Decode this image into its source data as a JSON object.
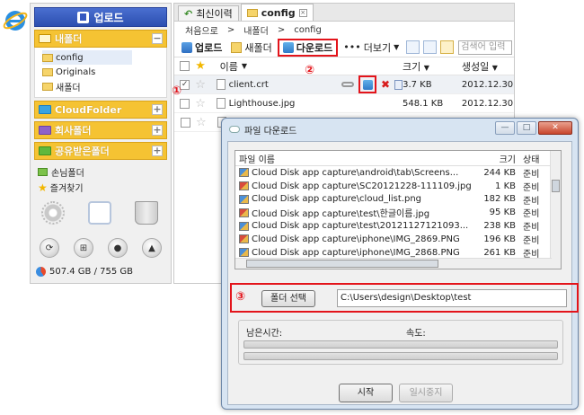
{
  "sidebar": {
    "upload_label": "업로드",
    "my_folder": "내폴더",
    "tree": [
      "config",
      "Originals",
      "새폴더"
    ],
    "cloud_folder": "CloudFolder",
    "company_folder": "회사폴더",
    "shared_folder": "공유받은폴더",
    "guest_folder": "손님폴더",
    "favorites": "즐겨찾기",
    "storage": "507.4 GB / 755 GB"
  },
  "tabs": {
    "history": "최신이력",
    "config": "config"
  },
  "breadcrumb": [
    "처음으로",
    ">",
    "내폴더",
    ">",
    "config"
  ],
  "toolbar": {
    "upload": "업로드",
    "new_folder": "새폴더",
    "download": "다운로드",
    "more": "더보기",
    "search_placeholder": "검색어 입력"
  },
  "table": {
    "col_name": "이름",
    "col_size": "크기",
    "col_date": "생성일",
    "rows": [
      {
        "name": "client.crt",
        "size": "3.7 KB",
        "date": "2012.12.30"
      },
      {
        "name": "Lighthouse.jpg",
        "size": "548.1 KB",
        "date": "2012.12.30"
      }
    ]
  },
  "badges": [
    "①",
    "②",
    "③"
  ],
  "dialog": {
    "title": "파일 다운로드",
    "col_name": "파일 이름",
    "col_size": "크기",
    "col_status": "상태",
    "files": [
      {
        "name": "Cloud Disk app capture\\android\\tab\\Screens...",
        "size": "244 KB",
        "status": "준비"
      },
      {
        "name": "Cloud Disk app capture\\SC20121228-111109.jpg",
        "size": "1 KB",
        "status": "준비"
      },
      {
        "name": "Cloud Disk app capture\\cloud_list.png",
        "size": "182 KB",
        "status": "준비"
      },
      {
        "name": "Cloud Disk app capture\\test\\한글이름.jpg",
        "size": "95 KB",
        "status": "준비"
      },
      {
        "name": "Cloud Disk app capture\\test\\20121127121093...",
        "size": "238 KB",
        "status": "준비"
      },
      {
        "name": "Cloud Disk app capture\\iphone\\IMG_2869.PNG",
        "size": "196 KB",
        "status": "준비"
      },
      {
        "name": "Cloud Disk app capture\\iphone\\IMG_2868.PNG",
        "size": "261 KB",
        "status": "준비"
      }
    ],
    "folder_button": "폴더 선택",
    "folder_path": "C:\\Users\\design\\Desktop\\test",
    "remaining_label": "남은시간:",
    "speed_label": "속도:",
    "remaining_progress": 0,
    "speed_progress": 0,
    "start_button": "시작",
    "pause_button": "일시중지"
  }
}
